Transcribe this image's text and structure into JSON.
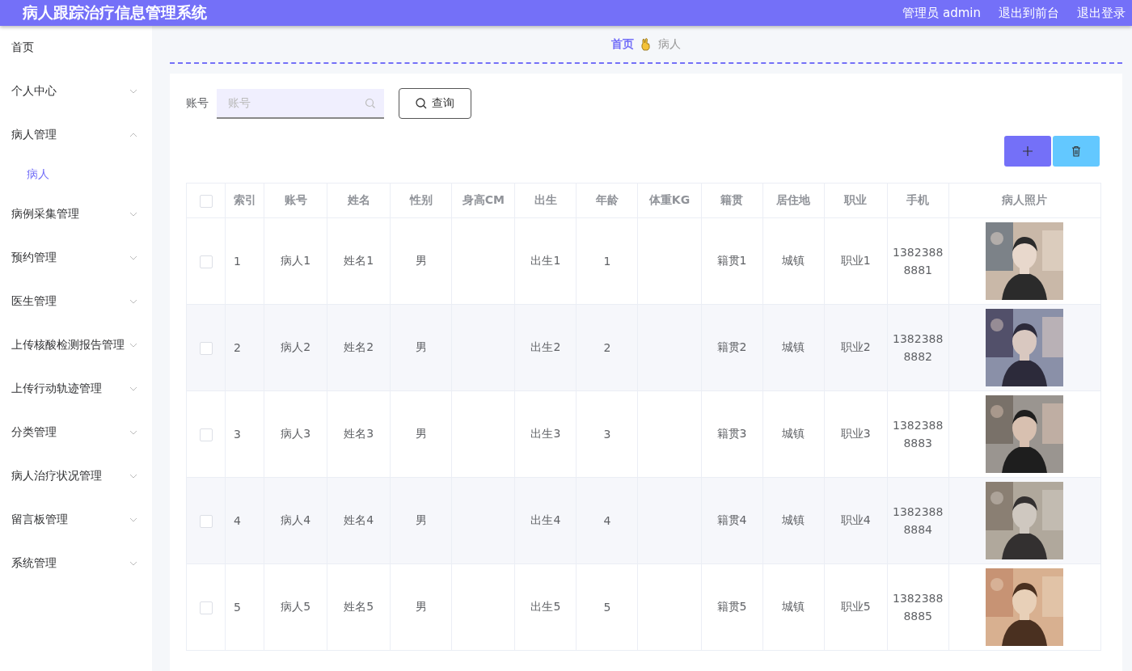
{
  "header": {
    "title": "病人跟踪治疗信息管理系统",
    "links": [
      "管理员 admin",
      "退出到前台",
      "退出登录"
    ]
  },
  "sidebar": {
    "items": [
      {
        "label": "首页",
        "kind": "link"
      },
      {
        "label": "个人中心",
        "kind": "menu",
        "expanded": false
      },
      {
        "label": "病人管理",
        "kind": "menu",
        "expanded": true,
        "children": [
          {
            "label": "病人",
            "selected": true
          }
        ]
      },
      {
        "label": "病例采集管理",
        "kind": "menu",
        "expanded": false
      },
      {
        "label": "预约管理",
        "kind": "menu",
        "expanded": false
      },
      {
        "label": "医生管理",
        "kind": "menu",
        "expanded": false
      },
      {
        "label": "上传核酸检测报告管理",
        "kind": "menu",
        "expanded": false
      },
      {
        "label": "上传行动轨迹管理",
        "kind": "menu",
        "expanded": false
      },
      {
        "label": "分类管理",
        "kind": "menu",
        "expanded": false
      },
      {
        "label": "病人治疗状况管理",
        "kind": "menu",
        "expanded": false
      },
      {
        "label": "留言板管理",
        "kind": "menu",
        "expanded": false
      },
      {
        "label": "系统管理",
        "kind": "menu",
        "expanded": false
      }
    ]
  },
  "breadcrumb": [
    "首页",
    "病人"
  ],
  "search": {
    "label": "账号",
    "placeholder": "账号",
    "button": "查询"
  },
  "table": {
    "select_all": {
      "checked": false
    },
    "columns": [
      "索引",
      "账号",
      "姓名",
      "性别",
      "身高CM",
      "出生",
      "年龄",
      "体重KG",
      "籍贯",
      "居住地",
      "职业",
      "手机",
      "病人照片"
    ],
    "rows": [
      {
        "checked": false,
        "cells": [
          "1",
          "病人1",
          "姓名1",
          "男",
          "",
          "出生1",
          "1",
          "",
          "籍贯1",
          "城镇",
          "职业1",
          "13823888881"
        ],
        "photo": {
          "kind": "picture"
        }
      },
      {
        "checked": false,
        "cells": [
          "2",
          "病人2",
          "姓名2",
          "男",
          "",
          "出生2",
          "2",
          "",
          "籍贯2",
          "城镇",
          "职业2",
          "13823888882"
        ],
        "photo": {
          "kind": "picture"
        }
      },
      {
        "checked": false,
        "cells": [
          "3",
          "病人3",
          "姓名3",
          "男",
          "",
          "出生3",
          "3",
          "",
          "籍贯3",
          "城镇",
          "职业3",
          "13823888883"
        ],
        "photo": {
          "kind": "picture"
        }
      },
      {
        "checked": false,
        "cells": [
          "4",
          "病人4",
          "姓名4",
          "男",
          "",
          "出生4",
          "4",
          "",
          "籍贯4",
          "城镇",
          "职业4",
          "13823888884"
        ],
        "photo": {
          "kind": "picture"
        }
      },
      {
        "checked": false,
        "cells": [
          "5",
          "病人5",
          "姓名5",
          "男",
          "",
          "出生5",
          "5",
          "",
          "籍贯5",
          "城镇",
          "职业5",
          "13823888885"
        ],
        "photo": {
          "kind": "picture"
        }
      }
    ]
  }
}
